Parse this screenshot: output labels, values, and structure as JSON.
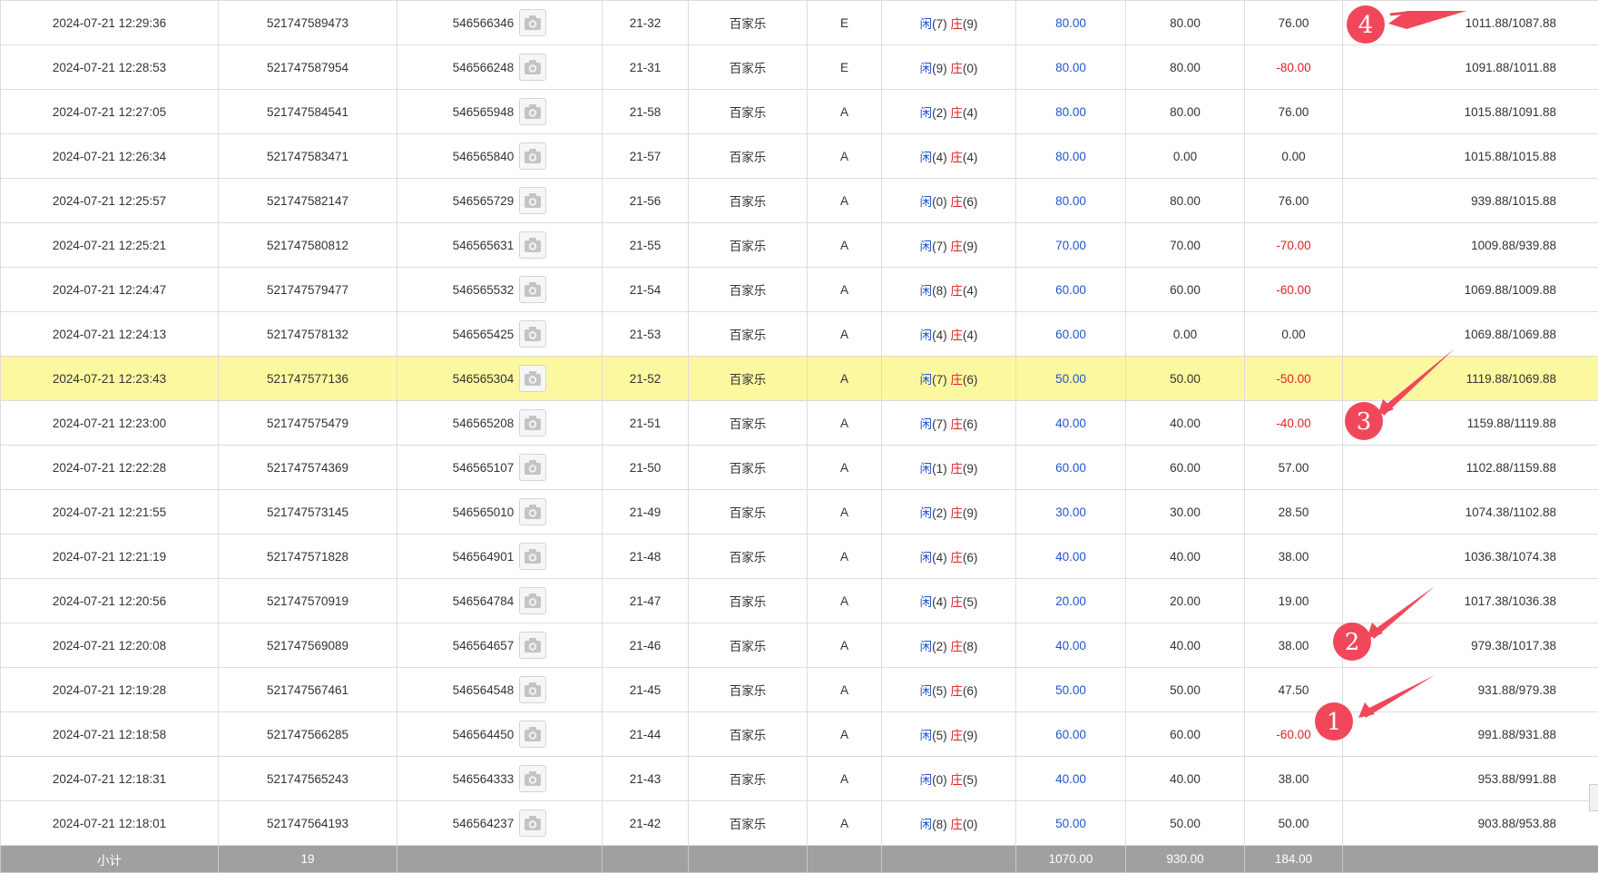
{
  "rows": [
    {
      "time": "2024-07-21 12:29:36",
      "order_id": "521747589473",
      "bet_id": "546566346",
      "round": "21-32",
      "game": "百家乐",
      "table": "E",
      "player_label": "闲",
      "player_points": "(7)",
      "banker_label": "庄",
      "banker_points": "(9)",
      "bet_amount": "80.00",
      "valid_amount": "80.00",
      "win_loss": "76.00",
      "balance": "1011.88/1087.88",
      "win_negative": false,
      "highlight": false
    },
    {
      "time": "2024-07-21 12:28:53",
      "order_id": "521747587954",
      "bet_id": "546566248",
      "round": "21-31",
      "game": "百家乐",
      "table": "E",
      "player_label": "闲",
      "player_points": "(9)",
      "banker_label": "庄",
      "banker_points": "(0)",
      "bet_amount": "80.00",
      "valid_amount": "80.00",
      "win_loss": "-80.00",
      "balance": "1091.88/1011.88",
      "win_negative": true,
      "highlight": false
    },
    {
      "time": "2024-07-21 12:27:05",
      "order_id": "521747584541",
      "bet_id": "546565948",
      "round": "21-58",
      "game": "百家乐",
      "table": "A",
      "player_label": "闲",
      "player_points": "(2)",
      "banker_label": "庄",
      "banker_points": "(4)",
      "bet_amount": "80.00",
      "valid_amount": "80.00",
      "win_loss": "76.00",
      "balance": "1015.88/1091.88",
      "win_negative": false,
      "highlight": false
    },
    {
      "time": "2024-07-21 12:26:34",
      "order_id": "521747583471",
      "bet_id": "546565840",
      "round": "21-57",
      "game": "百家乐",
      "table": "A",
      "player_label": "闲",
      "player_points": "(4)",
      "banker_label": "庄",
      "banker_points": "(4)",
      "bet_amount": "80.00",
      "valid_amount": "0.00",
      "win_loss": "0.00",
      "balance": "1015.88/1015.88",
      "win_negative": false,
      "highlight": false
    },
    {
      "time": "2024-07-21 12:25:57",
      "order_id": "521747582147",
      "bet_id": "546565729",
      "round": "21-56",
      "game": "百家乐",
      "table": "A",
      "player_label": "闲",
      "player_points": "(0)",
      "banker_label": "庄",
      "banker_points": "(6)",
      "bet_amount": "80.00",
      "valid_amount": "80.00",
      "win_loss": "76.00",
      "balance": "939.88/1015.88",
      "win_negative": false,
      "highlight": false
    },
    {
      "time": "2024-07-21 12:25:21",
      "order_id": "521747580812",
      "bet_id": "546565631",
      "round": "21-55",
      "game": "百家乐",
      "table": "A",
      "player_label": "闲",
      "player_points": "(7)",
      "banker_label": "庄",
      "banker_points": "(9)",
      "bet_amount": "70.00",
      "valid_amount": "70.00",
      "win_loss": "-70.00",
      "balance": "1009.88/939.88",
      "win_negative": true,
      "highlight": false
    },
    {
      "time": "2024-07-21 12:24:47",
      "order_id": "521747579477",
      "bet_id": "546565532",
      "round": "21-54",
      "game": "百家乐",
      "table": "A",
      "player_label": "闲",
      "player_points": "(8)",
      "banker_label": "庄",
      "banker_points": "(4)",
      "bet_amount": "60.00",
      "valid_amount": "60.00",
      "win_loss": "-60.00",
      "balance": "1069.88/1009.88",
      "win_negative": true,
      "highlight": false
    },
    {
      "time": "2024-07-21 12:24:13",
      "order_id": "521747578132",
      "bet_id": "546565425",
      "round": "21-53",
      "game": "百家乐",
      "table": "A",
      "player_label": "闲",
      "player_points": "(4)",
      "banker_label": "庄",
      "banker_points": "(4)",
      "bet_amount": "60.00",
      "valid_amount": "0.00",
      "win_loss": "0.00",
      "balance": "1069.88/1069.88",
      "win_negative": false,
      "highlight": false
    },
    {
      "time": "2024-07-21 12:23:43",
      "order_id": "521747577136",
      "bet_id": "546565304",
      "round": "21-52",
      "game": "百家乐",
      "table": "A",
      "player_label": "闲",
      "player_points": "(7)",
      "banker_label": "庄",
      "banker_points": "(6)",
      "bet_amount": "50.00",
      "valid_amount": "50.00",
      "win_loss": "-50.00",
      "balance": "1119.88/1069.88",
      "win_negative": true,
      "highlight": true
    },
    {
      "time": "2024-07-21 12:23:00",
      "order_id": "521747575479",
      "bet_id": "546565208",
      "round": "21-51",
      "game": "百家乐",
      "table": "A",
      "player_label": "闲",
      "player_points": "(7)",
      "banker_label": "庄",
      "banker_points": "(6)",
      "bet_amount": "40.00",
      "valid_amount": "40.00",
      "win_loss": "-40.00",
      "balance": "1159.88/1119.88",
      "win_negative": true,
      "highlight": false
    },
    {
      "time": "2024-07-21 12:22:28",
      "order_id": "521747574369",
      "bet_id": "546565107",
      "round": "21-50",
      "game": "百家乐",
      "table": "A",
      "player_label": "闲",
      "player_points": "(1)",
      "banker_label": "庄",
      "banker_points": "(9)",
      "bet_amount": "60.00",
      "valid_amount": "60.00",
      "win_loss": "57.00",
      "balance": "1102.88/1159.88",
      "win_negative": false,
      "highlight": false
    },
    {
      "time": "2024-07-21 12:21:55",
      "order_id": "521747573145",
      "bet_id": "546565010",
      "round": "21-49",
      "game": "百家乐",
      "table": "A",
      "player_label": "闲",
      "player_points": "(2)",
      "banker_label": "庄",
      "banker_points": "(9)",
      "bet_amount": "30.00",
      "valid_amount": "30.00",
      "win_loss": "28.50",
      "balance": "1074.38/1102.88",
      "win_negative": false,
      "highlight": false
    },
    {
      "time": "2024-07-21 12:21:19",
      "order_id": "521747571828",
      "bet_id": "546564901",
      "round": "21-48",
      "game": "百家乐",
      "table": "A",
      "player_label": "闲",
      "player_points": "(4)",
      "banker_label": "庄",
      "banker_points": "(6)",
      "bet_amount": "40.00",
      "valid_amount": "40.00",
      "win_loss": "38.00",
      "balance": "1036.38/1074.38",
      "win_negative": false,
      "highlight": false
    },
    {
      "time": "2024-07-21 12:20:56",
      "order_id": "521747570919",
      "bet_id": "546564784",
      "round": "21-47",
      "game": "百家乐",
      "table": "A",
      "player_label": "闲",
      "player_points": "(4)",
      "banker_label": "庄",
      "banker_points": "(5)",
      "bet_amount": "20.00",
      "valid_amount": "20.00",
      "win_loss": "19.00",
      "balance": "1017.38/1036.38",
      "win_negative": false,
      "highlight": false
    },
    {
      "time": "2024-07-21 12:20:08",
      "order_id": "521747569089",
      "bet_id": "546564657",
      "round": "21-46",
      "game": "百家乐",
      "table": "A",
      "player_label": "闲",
      "player_points": "(2)",
      "banker_label": "庄",
      "banker_points": "(8)",
      "bet_amount": "40.00",
      "valid_amount": "40.00",
      "win_loss": "38.00",
      "balance": "979.38/1017.38",
      "win_negative": false,
      "highlight": false
    },
    {
      "time": "2024-07-21 12:19:28",
      "order_id": "521747567461",
      "bet_id": "546564548",
      "round": "21-45",
      "game": "百家乐",
      "table": "A",
      "player_label": "闲",
      "player_points": "(5)",
      "banker_label": "庄",
      "banker_points": "(6)",
      "bet_amount": "50.00",
      "valid_amount": "50.00",
      "win_loss": "47.50",
      "balance": "931.88/979.38",
      "win_negative": false,
      "highlight": false
    },
    {
      "time": "2024-07-21 12:18:58",
      "order_id": "521747566285",
      "bet_id": "546564450",
      "round": "21-44",
      "game": "百家乐",
      "table": "A",
      "player_label": "闲",
      "player_points": "(5)",
      "banker_label": "庄",
      "banker_points": "(9)",
      "bet_amount": "60.00",
      "valid_amount": "60.00",
      "win_loss": "-60.00",
      "balance": "991.88/931.88",
      "win_negative": true,
      "highlight": false
    },
    {
      "time": "2024-07-21 12:18:31",
      "order_id": "521747565243",
      "bet_id": "546564333",
      "round": "21-43",
      "game": "百家乐",
      "table": "A",
      "player_label": "闲",
      "player_points": "(0)",
      "banker_label": "庄",
      "banker_points": "(5)",
      "bet_amount": "40.00",
      "valid_amount": "40.00",
      "win_loss": "38.00",
      "balance": "953.88/991.88",
      "win_negative": false,
      "highlight": false
    },
    {
      "time": "2024-07-21 12:18:01",
      "order_id": "521747564193",
      "bet_id": "546564237",
      "round": "21-42",
      "game": "百家乐",
      "table": "A",
      "player_label": "闲",
      "player_points": "(8)",
      "banker_label": "庄",
      "banker_points": "(0)",
      "bet_amount": "50.00",
      "valid_amount": "50.00",
      "win_loss": "50.00",
      "balance": "903.88/953.88",
      "win_negative": false,
      "highlight": false
    }
  ],
  "totals": {
    "label": "小计",
    "count": "19",
    "bet_amount": "1070.00",
    "valid_amount": "930.00",
    "win_loss": "184.00"
  },
  "annotations": [
    {
      "label": "4"
    },
    {
      "label": "3"
    },
    {
      "label": "2"
    },
    {
      "label": "1"
    }
  ],
  "colors": {
    "highlight_row": "#fcf8a0",
    "amount_blue": "#2255cc",
    "loss_red": "#dd2222",
    "total_bar": "#a0a0a0",
    "marker_red": "#f0485a"
  },
  "icons": {
    "bet_photo": "camera-icon"
  }
}
